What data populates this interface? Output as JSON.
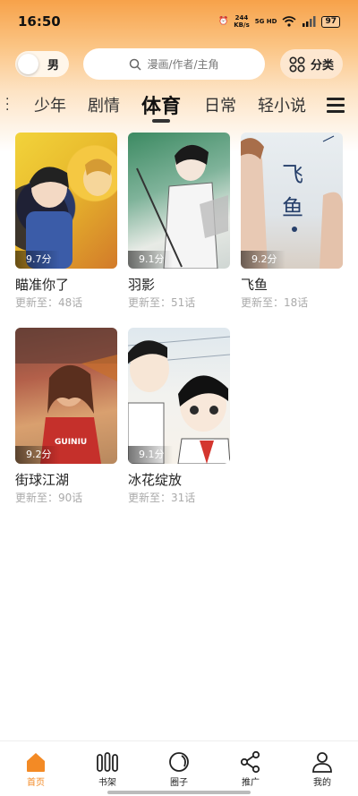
{
  "status": {
    "time": "16:50",
    "speed_value": "244",
    "speed_unit": "KB/s",
    "network": "5G HD",
    "battery": "97"
  },
  "header": {
    "gender_label": "男",
    "search_placeholder": "漫画/作者/主角",
    "category_label": "分类"
  },
  "tabs": [
    {
      "label": "少年"
    },
    {
      "label": "剧情"
    },
    {
      "label": "体育"
    },
    {
      "label": "日常"
    },
    {
      "label": "轻小说"
    }
  ],
  "active_tab": "体育",
  "comics": [
    {
      "title": "瞄准你了",
      "score": "9.7分",
      "update": "更新至：48话"
    },
    {
      "title": "羽影",
      "score": "9.1分",
      "update": "更新至：51话"
    },
    {
      "title": "飞鱼",
      "score": "9.2分",
      "update": "更新至：18话",
      "cover_text": "飞 鱼"
    },
    {
      "title": "街球江湖",
      "score": "9.2分",
      "update": "更新至：90话",
      "cover_text": "GUINIU"
    },
    {
      "title": "冰花绽放",
      "score": "9.1分",
      "update": "更新至：31话"
    }
  ],
  "bottom_nav": [
    {
      "label": "首页",
      "icon": "home-icon",
      "active": true
    },
    {
      "label": "书架",
      "icon": "bookshelf-icon"
    },
    {
      "label": "圈子",
      "icon": "circle-icon"
    },
    {
      "label": "推广",
      "icon": "share-icon"
    },
    {
      "label": "我的",
      "icon": "user-icon"
    }
  ],
  "colors": {
    "accent": "#f38a25",
    "header_gradient_top": "#f7a24a"
  }
}
